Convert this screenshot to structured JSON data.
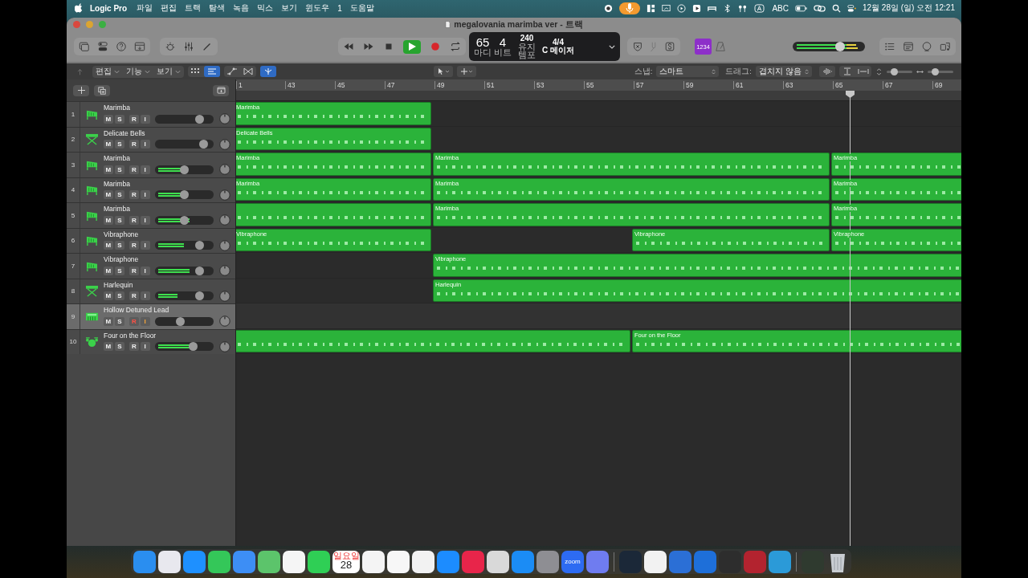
{
  "menubar": {
    "app": "Logic Pro",
    "menus": [
      "파일",
      "편집",
      "트랙",
      "탐색",
      "녹음",
      "믹스",
      "보기",
      "윈도우",
      "1",
      "도움말"
    ],
    "input_label": "ABC",
    "clock": "12월 28일 (일) 오전 12:21"
  },
  "window": {
    "title": "megalovania marimba ver - 트랙"
  },
  "lcd": {
    "bar": "65",
    "beat": "4",
    "bar_label": "마디",
    "beat_label": "비트",
    "tempo": "240",
    "tempo_mode": "유지",
    "tempo_label": "템포",
    "signature": "4/4",
    "key": "C 메이저"
  },
  "toolbar": {
    "playing": true,
    "count_in": "1234",
    "master_volume": {
      "level": 0.68
    }
  },
  "controls": {
    "menus": [
      "편집",
      "기능",
      "보기"
    ],
    "snap_label": "스냅:",
    "snap": "스마트",
    "drag_label": "드래그:",
    "drag": "겹치지 않음",
    "vertical_zoom": {
      "level": 0.2
    },
    "horizontal_zoom": {
      "level": 0.2
    }
  },
  "ruler": [
    "1",
    "43",
    "45",
    "47",
    "49",
    "51",
    "53",
    "55",
    "57",
    "59",
    "61",
    "63",
    "65",
    "67",
    "69"
  ],
  "tracks": [
    {
      "number": "1",
      "name": "Marimba",
      "kind": "mallet",
      "buttons": [
        "M",
        "S",
        "R",
        "I"
      ],
      "selected": false,
      "armed": false,
      "volume": {
        "level": 0.82
      },
      "regions": [
        {
          "kind": "midi",
          "name": "Marimba"
        }
      ]
    },
    {
      "number": "2",
      "name": "Delicate Bells",
      "kind": "keyboard",
      "buttons": [
        "M",
        "S",
        "R",
        "I"
      ],
      "selected": false,
      "armed": false,
      "volume": {
        "level": 0.9
      },
      "regions": [
        {
          "kind": "midi",
          "name": "Delicate Bells"
        }
      ]
    },
    {
      "number": "3",
      "name": "Marimba",
      "kind": "mallet",
      "buttons": [
        "M",
        "S",
        "R",
        "I"
      ],
      "selected": false,
      "armed": false,
      "volume": {
        "level": 0.5
      },
      "meter": {
        "level": 0.55
      },
      "regions": [
        {
          "kind": "midi",
          "name": "Marimba"
        },
        {
          "kind": "midi",
          "name": "Marimba"
        },
        {
          "kind": "midi",
          "name": "Marimba"
        }
      ]
    },
    {
      "number": "4",
      "name": "Marimba",
      "kind": "mallet",
      "buttons": [
        "M",
        "S",
        "R",
        "I"
      ],
      "selected": false,
      "armed": false,
      "volume": {
        "level": 0.5
      },
      "meter": {
        "level": 0.55
      },
      "regions": [
        {
          "kind": "midi",
          "name": "Marimba"
        },
        {
          "kind": "midi",
          "name": "Marimba"
        },
        {
          "kind": "midi",
          "name": "Marimba"
        }
      ]
    },
    {
      "number": "5",
      "name": "Marimba",
      "kind": "mallet",
      "buttons": [
        "M",
        "S",
        "R",
        "I"
      ],
      "selected": false,
      "armed": false,
      "volume": {
        "level": 0.5
      },
      "meter": {
        "level": 0.62
      },
      "regions": [
        {
          "kind": "midi"
        },
        {
          "kind": "midi",
          "name": "Marimba"
        },
        {
          "kind": "midi",
          "name": "Marimba"
        }
      ]
    },
    {
      "number": "6",
      "name": "Vibraphone",
      "kind": "mallet",
      "buttons": [
        "M",
        "S",
        "R",
        "I"
      ],
      "selected": false,
      "armed": false,
      "volume": {
        "level": 0.82
      },
      "meter": {
        "level": 0.5
      },
      "regions": [
        {
          "kind": "midi",
          "name": "Vibraphone"
        },
        {
          "kind": "midi",
          "name": "Vibraphone"
        },
        {
          "kind": "midi",
          "name": "Vibraphone"
        }
      ]
    },
    {
      "number": "7",
      "name": "Vibraphone",
      "kind": "mallet",
      "buttons": [
        "M",
        "S",
        "R",
        "I"
      ],
      "selected": false,
      "armed": false,
      "volume": {
        "level": 0.82
      },
      "meter": {
        "level": 0.62
      },
      "regions": [
        {
          "kind": "midi",
          "name": "Vibraphone"
        }
      ]
    },
    {
      "number": "8",
      "name": "Harlequin",
      "kind": "keyboard",
      "buttons": [
        "M",
        "S",
        "R",
        "I"
      ],
      "selected": false,
      "armed": false,
      "volume": {
        "level": 0.82
      },
      "meter": {
        "level": 0.38
      },
      "regions": [
        {
          "kind": "midi",
          "name": "Harlequin"
        }
      ]
    },
    {
      "number": "9",
      "name": "Hollow Detuned Lead",
      "kind": "synth",
      "buttons": [
        "M",
        "S",
        "R",
        "I"
      ],
      "selected": true,
      "armed": true,
      "volume": {
        "level": 0.42
      }
    },
    {
      "number": "10",
      "name": "Four on the Floor",
      "kind": "drums",
      "buttons": [
        "M",
        "S",
        "R",
        "I"
      ],
      "selected": false,
      "armed": false,
      "volume": {
        "level": 0.68
      },
      "meter": {
        "level": 0.75
      },
      "regions": [
        {
          "kind": "midi"
        },
        {
          "kind": "midi",
          "name": "Four on the Floor"
        }
      ]
    }
  ],
  "dock": {
    "calendar_weekday": "일요일",
    "calendar_day": "28",
    "zoom_label": "zoom"
  }
}
